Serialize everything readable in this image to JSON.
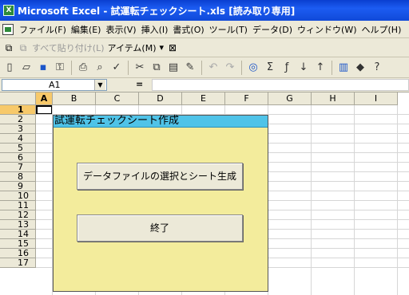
{
  "window": {
    "title": "Microsoft Excel - 試運転チェックシート.xls  [読み取り専用]",
    "app_icon": "excel-icon"
  },
  "menu": {
    "items": [
      "ファイル(F)",
      "編集(E)",
      "表示(V)",
      "挿入(I)",
      "書式(O)",
      "ツール(T)",
      "データ(D)",
      "ウィンドウ(W)",
      "ヘルプ(H)"
    ]
  },
  "toolbar2": {
    "paste_all_label": "すべて貼り付け(L)",
    "items_label": "アイテム(M)",
    "items_arrow": "▾"
  },
  "formula_bar": {
    "name_box": "A1",
    "equals": "="
  },
  "sheet": {
    "columns": [
      "A",
      "B",
      "C",
      "D",
      "E",
      "F",
      "G",
      "H",
      "I"
    ],
    "rows": [
      "1",
      "2",
      "3",
      "4",
      "5",
      "6",
      "7",
      "8",
      "9",
      "10",
      "11",
      "12",
      "13",
      "14",
      "15",
      "16",
      "17"
    ],
    "active_cell": "A1"
  },
  "dialog": {
    "title": "試運転チェックシート作成",
    "select_button": "データファイルの選択とシート生成",
    "exit_button": "終了"
  },
  "colors": {
    "title_bar": "#1c5cf2",
    "dialog_bg": "#f3ec9c",
    "dialog_title_bg": "#4fc3e8",
    "active_header": "#f7c96a"
  }
}
